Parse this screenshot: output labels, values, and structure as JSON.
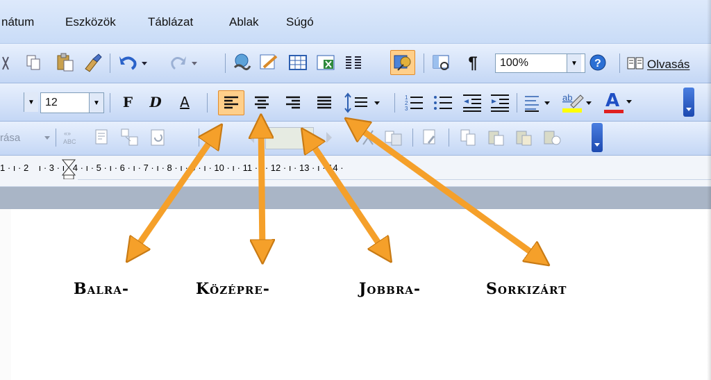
{
  "menubar": {
    "items": [
      {
        "label": "nátum"
      },
      {
        "label": "Eszközök"
      },
      {
        "label": "Táblázat"
      },
      {
        "label": "Ablak"
      },
      {
        "label": "Súgó"
      }
    ]
  },
  "standard_toolbar": {
    "zoom_value": "100%",
    "reading_label": "Olvasás",
    "pilcrow": "¶"
  },
  "format_toolbar": {
    "font_size": "12",
    "bold_label": "F",
    "italic_label": "D",
    "underline_label": "A",
    "font_color_label": "A",
    "highlight_label": "ab"
  },
  "review_toolbar": {
    "partial_label": "rása",
    "abc_label": "ABC"
  },
  "ruler": {
    "text": "1 · ı · 2    ı · 3 · ı · 4 · ı · 5 · ı · 6 · ı · 7 · ı · 8 · ı · 9 · ı · 10 · ı · 11 · ı · 12 · ı · 13 · ı · 14 ·"
  },
  "annotations": {
    "left": "Balra-",
    "center": "Középre-",
    "right": "Jobbra-",
    "justify": "Sorkizárt",
    "arrow_color": "#f5a02a"
  },
  "colors": {
    "active_button": "#ffcf8a",
    "toolbar_top": "#e8f0fd",
    "toolbar_bottom": "#c4d7f5"
  }
}
